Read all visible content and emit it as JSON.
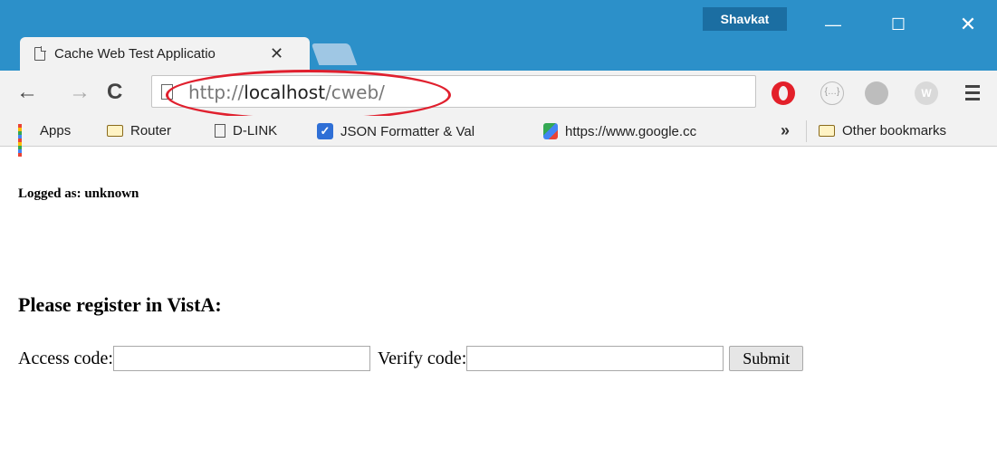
{
  "browser": {
    "profile_name": "Shavkat",
    "window_controls": {
      "minimize_icon": "—",
      "maximize_icon": "☐",
      "close_icon": "✕"
    },
    "tab": {
      "title": "Cache Web Test Applicatio",
      "close_icon": "✕"
    },
    "nav": {
      "back_icon": "←",
      "forward_icon": "→",
      "reload_icon": "C"
    },
    "address_bar": {
      "scheme": "http://",
      "host": "localhost",
      "path": "/cweb/"
    },
    "extensions": [
      "opera-icon",
      "json-viewer-icon",
      "compass-icon",
      "w-extension-icon"
    ],
    "extension_w_label": "W",
    "bookmarks": [
      {
        "label": "Apps",
        "icon": "apps-icon"
      },
      {
        "label": "Router",
        "icon": "folder-icon"
      },
      {
        "label": "D-LINK",
        "icon": "page-icon"
      },
      {
        "label": "JSON Formatter & Val",
        "icon": "checkbox-icon"
      },
      {
        "label": "https://www.google.cc",
        "icon": "maps-icon"
      }
    ],
    "bookmarks_overflow": "»",
    "other_bookmarks": "Other bookmarks"
  },
  "page": {
    "logged_status": "Logged as: unknown",
    "heading": "Please register in VistA:",
    "access_code_label": "Access code:",
    "verify_code_label": "Verify code:",
    "access_code_value": "",
    "verify_code_value": "",
    "submit_label": "Submit"
  },
  "colors": {
    "titlebar": "#2c90c9",
    "highlight_oval": "#e0202e"
  }
}
